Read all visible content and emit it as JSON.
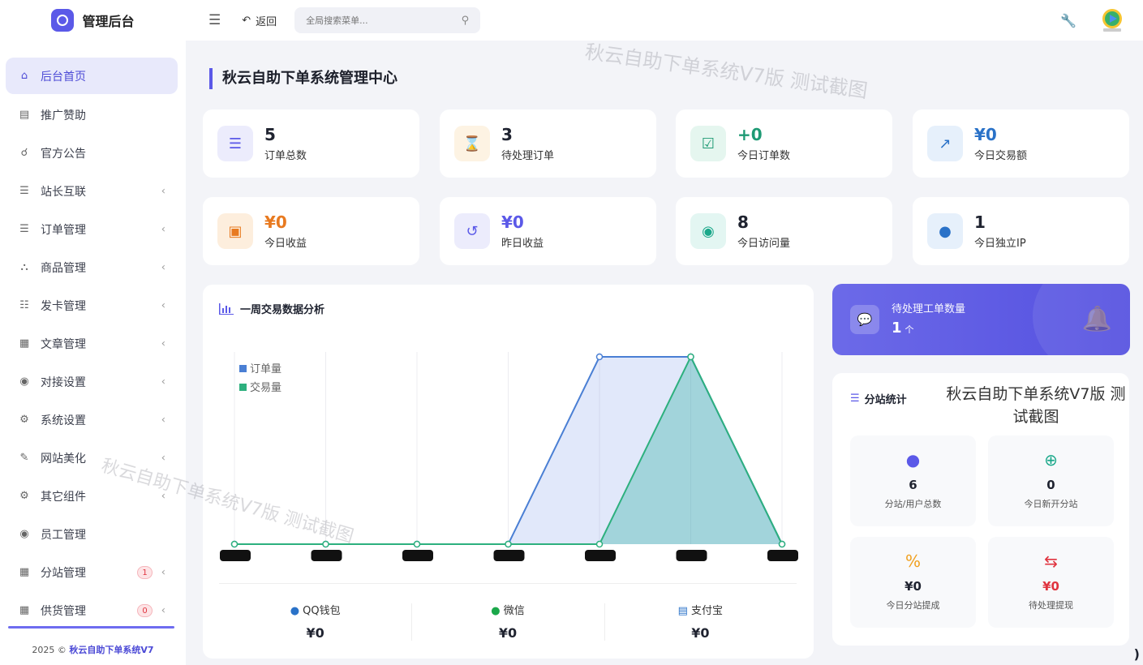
{
  "sidebar": {
    "brand": "管理后台",
    "items": [
      {
        "label": "后台首页",
        "icon": "home-icon"
      },
      {
        "label": "推广赞助",
        "icon": "image-icon"
      },
      {
        "label": "官方公告",
        "icon": "megaphone-icon"
      },
      {
        "label": "站长互联",
        "icon": "list-icon"
      },
      {
        "label": "订单管理",
        "icon": "list-icon"
      },
      {
        "label": "商品管理",
        "icon": "cart-icon"
      },
      {
        "label": "发卡管理",
        "icon": "grid-icon"
      },
      {
        "label": "文章管理",
        "icon": "book-icon"
      },
      {
        "label": "对接设置",
        "icon": "coins-icon"
      },
      {
        "label": "系统设置",
        "icon": "gear-icon"
      },
      {
        "label": "网站美化",
        "icon": "brush-icon"
      },
      {
        "label": "其它组件",
        "icon": "cogs-icon"
      },
      {
        "label": "员工管理",
        "icon": "user-circle-icon"
      },
      {
        "label": "分站管理",
        "icon": "sitemap-icon",
        "badge": "1"
      },
      {
        "label": "供货管理",
        "icon": "sitemap-icon",
        "badge": "0"
      }
    ],
    "footer_year": "2025 ©",
    "footer_name": "秋云自助下单系统V7"
  },
  "topbar": {
    "back_label": "返回",
    "search_placeholder": "全局搜索菜单..."
  },
  "page_title": "秋云自助下单系统管理中心",
  "stats": [
    {
      "value": "5",
      "label": "订单总数",
      "color": "#1f2330",
      "icon": "list-numbered-icon",
      "icon_bg": "#ececfc",
      "icon_color": "#5b59e8"
    },
    {
      "value": "3",
      "label": "待处理订单",
      "color": "#1f2330",
      "icon": "hourglass-icon",
      "icon_bg": "#fdf3e3",
      "icon_color": "#f0a020"
    },
    {
      "value": "+0",
      "label": "今日订单数",
      "color": "#1e9a74",
      "icon": "calendar-check-icon",
      "icon_bg": "#e5f6ef",
      "icon_color": "#1e9a74"
    },
    {
      "value": "¥0",
      "label": "今日交易额",
      "color": "#2a72c8",
      "icon": "chart-line-icon",
      "icon_bg": "#e6f0fb",
      "icon_color": "#2a72c8"
    },
    {
      "value": "¥0",
      "label": "今日收益",
      "color": "#e87a20",
      "icon": "money-bill-icon",
      "icon_bg": "#fdeedd",
      "icon_color": "#e87a20"
    },
    {
      "value": "¥0",
      "label": "昨日收益",
      "color": "#5b59e8",
      "icon": "history-icon",
      "icon_bg": "#ececfc",
      "icon_color": "#5b59e8"
    },
    {
      "value": "8",
      "label": "今日访问量",
      "color": "#1f2330",
      "icon": "eye-icon",
      "icon_bg": "#e3f6f2",
      "icon_color": "#1ba88a"
    },
    {
      "value": "1",
      "label": "今日独立IP",
      "color": "#1f2330",
      "icon": "users-icon",
      "icon_bg": "#e6f0fb",
      "icon_color": "#2a72c8"
    }
  ],
  "chart_title": "一周交易数据分析",
  "chart_data": {
    "type": "area",
    "x": [
      "",
      "",
      "",
      "",
      "",
      "",
      ""
    ],
    "series": [
      {
        "name": "订单量",
        "values": [
          0,
          0,
          0,
          0,
          1,
          1,
          0
        ],
        "color": "#4a7fd4"
      },
      {
        "name": "交易量",
        "values": [
          0,
          0,
          0,
          0,
          0,
          1,
          0
        ],
        "color": "#2db07e"
      }
    ],
    "grid": true,
    "legend": "top-left"
  },
  "payments": [
    {
      "name": "QQ钱包",
      "value": "¥0",
      "icon": "qq-icon",
      "color": "#2a72c8"
    },
    {
      "name": "微信",
      "value": "¥0",
      "icon": "wechat-icon",
      "color": "#1ba84a"
    },
    {
      "name": "支付宝",
      "value": "¥0",
      "icon": "credit-card-icon",
      "color": "#2a72c8"
    }
  ],
  "ticket": {
    "title": "待处理工单数量",
    "count": "1",
    "unit": "个"
  },
  "branch": {
    "title": "分站统计",
    "cells": [
      {
        "value": "6",
        "label": "分站/用户总数",
        "icon": "users-icon",
        "icon_color": "#5b59e8",
        "value_color": "#1f2330"
      },
      {
        "value": "0",
        "label": "今日新开分站",
        "icon": "plus-circle-icon",
        "icon_color": "#1ba88a",
        "value_color": "#1f2330"
      },
      {
        "value": "¥0",
        "label": "今日分站提成",
        "icon": "percent-icon",
        "icon_color": "#f0a020",
        "value_color": "#1f2330"
      },
      {
        "value": "¥0",
        "label": "待处理提现",
        "icon": "exchange-icon",
        "icon_color": "#e0343f",
        "value_color": "#e0343f"
      }
    ]
  },
  "watermarks": {
    "top": "秋云自助下单系统V7版 测试截图",
    "mid": "秋云自助下单系统V7版 测试截图",
    "solid": "秋云自助下单系统V7版 测试截图"
  }
}
